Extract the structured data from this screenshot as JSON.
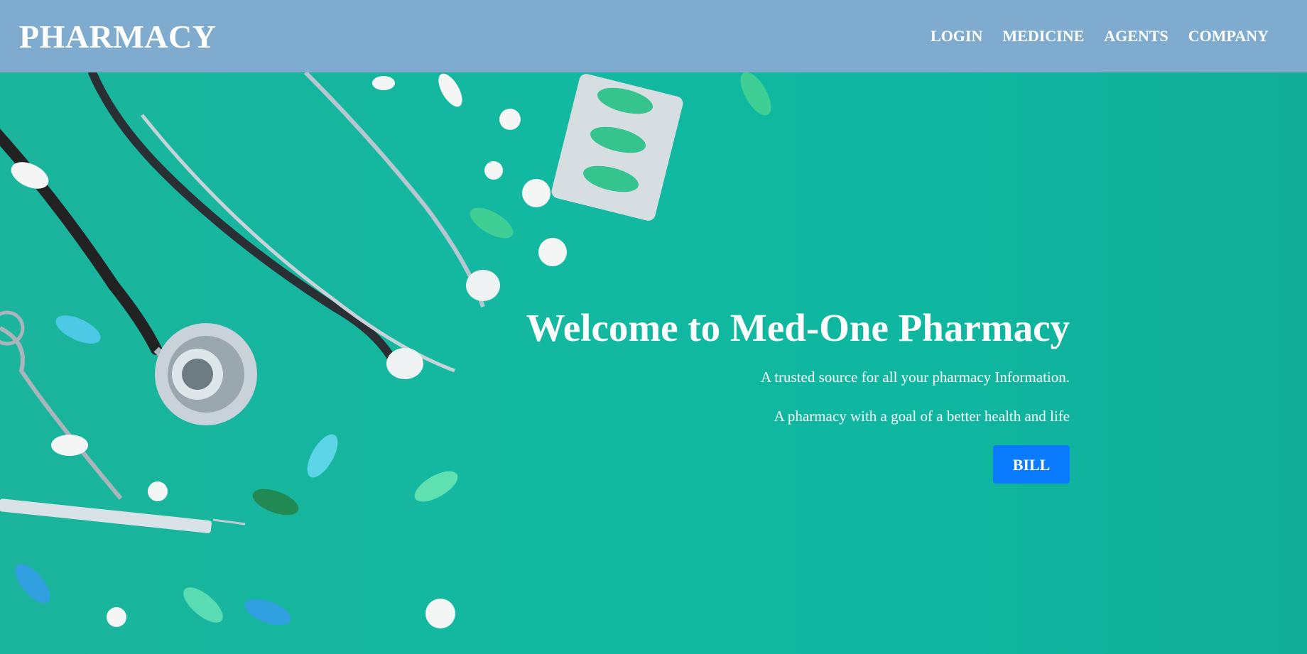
{
  "navbar": {
    "brand": "PHARMACY",
    "links": [
      {
        "label": "LOGIN"
      },
      {
        "label": "MEDICINE"
      },
      {
        "label": "AGENTS"
      },
      {
        "label": "COMPANY"
      }
    ]
  },
  "hero": {
    "title": "Welcome to Med-One Pharmacy",
    "line1": "A trusted source for all your pharmacy Information.",
    "line2": "A pharmacy with a goal of a better health and life",
    "button_label": "BILL",
    "image_description_icon": "stethoscope-and-pills-icon"
  },
  "colors": {
    "navbar_bg": "#7facce",
    "hero_bg": "#12b8a0",
    "button_bg": "#0a7bff",
    "text": "#ffffff"
  }
}
